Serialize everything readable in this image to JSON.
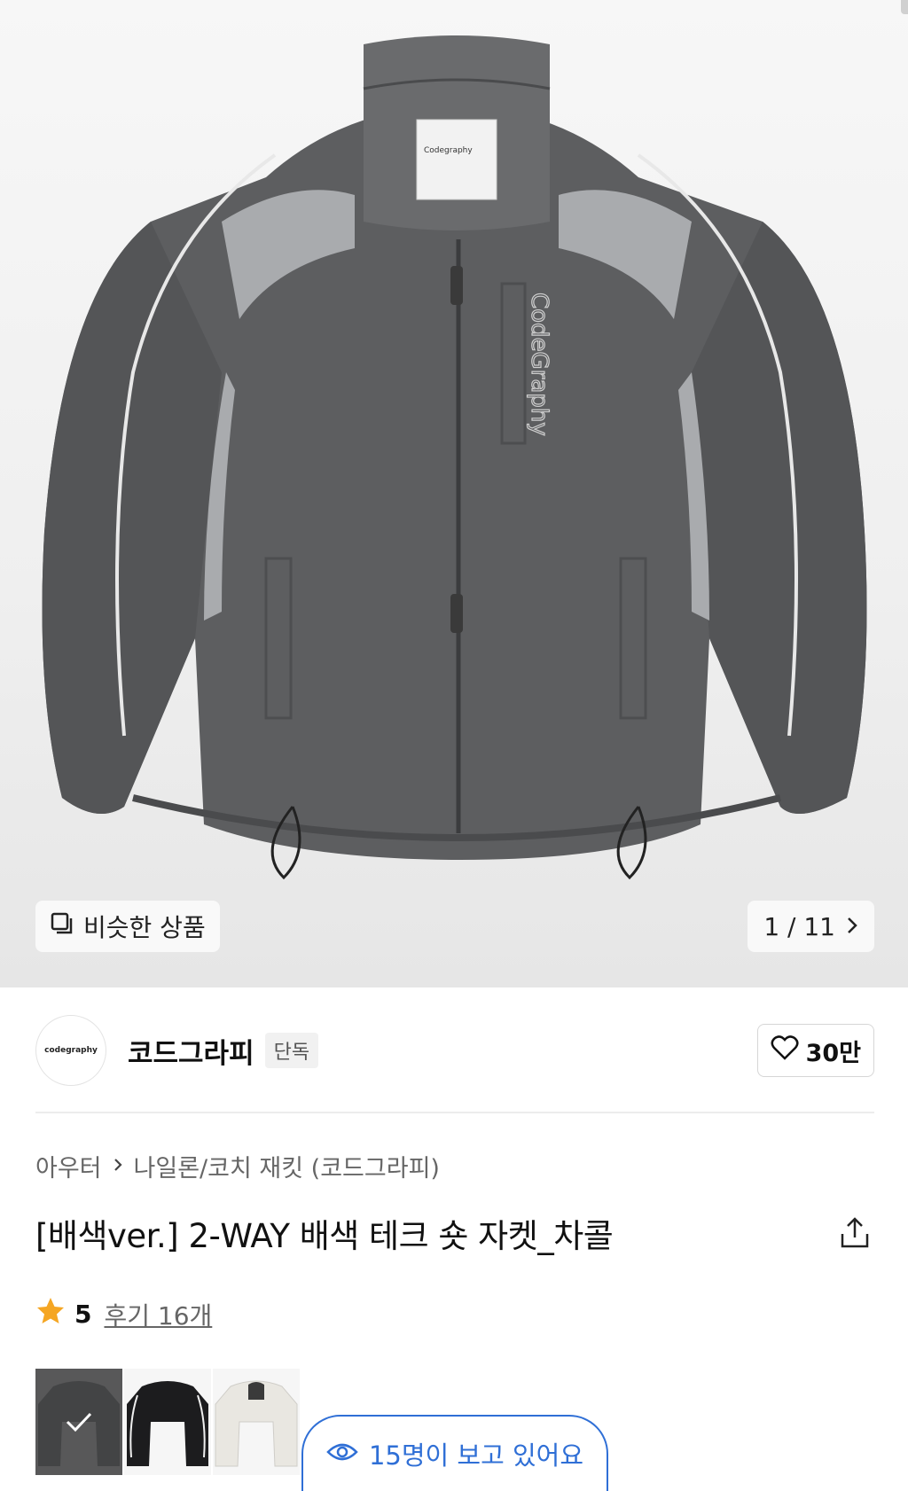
{
  "gallery": {
    "similar_label": "비슷한 상품",
    "counter": "1 / 11",
    "image_label_brand": "Codegraphy"
  },
  "brand": {
    "logo_text": "codegraphy",
    "name": "코드그라피",
    "tag": "단독",
    "likes": "30만"
  },
  "breadcrumb": {
    "level1": "아우터",
    "level2": "나일론/코치 재킷 (코드그라피)"
  },
  "product": {
    "title": "[배색ver.] 2-WAY 배색 테크 숏 자켓_차콜"
  },
  "rating": {
    "score": "5",
    "reviews": "후기 16개"
  },
  "color_options": [
    {
      "name": "charcoal",
      "color": "#4a4b4d",
      "selected": true
    },
    {
      "name": "black",
      "color": "#1c1c1e",
      "selected": false
    },
    {
      "name": "ivory",
      "color": "#e9e7e1",
      "selected": false
    }
  ],
  "viewers": {
    "text": "15명이 보고 있어요"
  },
  "colors": {
    "accent_blue": "#2f6fd6",
    "star": "#f5a623",
    "jacket_main": "#5b5c5e",
    "jacket_panel": "#a9abae"
  }
}
